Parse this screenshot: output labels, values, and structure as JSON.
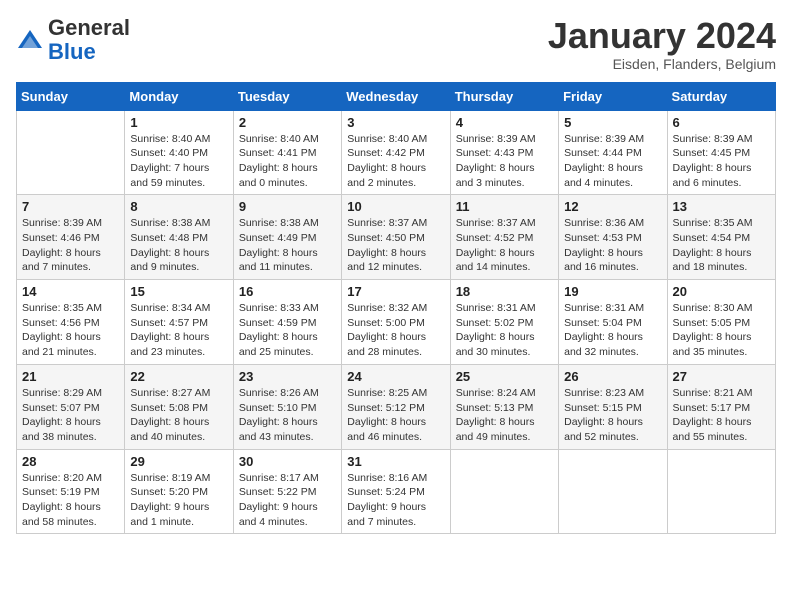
{
  "logo": {
    "general": "General",
    "blue": "Blue"
  },
  "header": {
    "month": "January 2024",
    "location": "Eisden, Flanders, Belgium"
  },
  "weekdays": [
    "Sunday",
    "Monday",
    "Tuesday",
    "Wednesday",
    "Thursday",
    "Friday",
    "Saturday"
  ],
  "weeks": [
    [
      {
        "day": "",
        "info": ""
      },
      {
        "day": "1",
        "info": "Sunrise: 8:40 AM\nSunset: 4:40 PM\nDaylight: 7 hours\nand 59 minutes."
      },
      {
        "day": "2",
        "info": "Sunrise: 8:40 AM\nSunset: 4:41 PM\nDaylight: 8 hours\nand 0 minutes."
      },
      {
        "day": "3",
        "info": "Sunrise: 8:40 AM\nSunset: 4:42 PM\nDaylight: 8 hours\nand 2 minutes."
      },
      {
        "day": "4",
        "info": "Sunrise: 8:39 AM\nSunset: 4:43 PM\nDaylight: 8 hours\nand 3 minutes."
      },
      {
        "day": "5",
        "info": "Sunrise: 8:39 AM\nSunset: 4:44 PM\nDaylight: 8 hours\nand 4 minutes."
      },
      {
        "day": "6",
        "info": "Sunrise: 8:39 AM\nSunset: 4:45 PM\nDaylight: 8 hours\nand 6 minutes."
      }
    ],
    [
      {
        "day": "7",
        "info": "Sunrise: 8:39 AM\nSunset: 4:46 PM\nDaylight: 8 hours\nand 7 minutes."
      },
      {
        "day": "8",
        "info": "Sunrise: 8:38 AM\nSunset: 4:48 PM\nDaylight: 8 hours\nand 9 minutes."
      },
      {
        "day": "9",
        "info": "Sunrise: 8:38 AM\nSunset: 4:49 PM\nDaylight: 8 hours\nand 11 minutes."
      },
      {
        "day": "10",
        "info": "Sunrise: 8:37 AM\nSunset: 4:50 PM\nDaylight: 8 hours\nand 12 minutes."
      },
      {
        "day": "11",
        "info": "Sunrise: 8:37 AM\nSunset: 4:52 PM\nDaylight: 8 hours\nand 14 minutes."
      },
      {
        "day": "12",
        "info": "Sunrise: 8:36 AM\nSunset: 4:53 PM\nDaylight: 8 hours\nand 16 minutes."
      },
      {
        "day": "13",
        "info": "Sunrise: 8:35 AM\nSunset: 4:54 PM\nDaylight: 8 hours\nand 18 minutes."
      }
    ],
    [
      {
        "day": "14",
        "info": "Sunrise: 8:35 AM\nSunset: 4:56 PM\nDaylight: 8 hours\nand 21 minutes."
      },
      {
        "day": "15",
        "info": "Sunrise: 8:34 AM\nSunset: 4:57 PM\nDaylight: 8 hours\nand 23 minutes."
      },
      {
        "day": "16",
        "info": "Sunrise: 8:33 AM\nSunset: 4:59 PM\nDaylight: 8 hours\nand 25 minutes."
      },
      {
        "day": "17",
        "info": "Sunrise: 8:32 AM\nSunset: 5:00 PM\nDaylight: 8 hours\nand 28 minutes."
      },
      {
        "day": "18",
        "info": "Sunrise: 8:31 AM\nSunset: 5:02 PM\nDaylight: 8 hours\nand 30 minutes."
      },
      {
        "day": "19",
        "info": "Sunrise: 8:31 AM\nSunset: 5:04 PM\nDaylight: 8 hours\nand 32 minutes."
      },
      {
        "day": "20",
        "info": "Sunrise: 8:30 AM\nSunset: 5:05 PM\nDaylight: 8 hours\nand 35 minutes."
      }
    ],
    [
      {
        "day": "21",
        "info": "Sunrise: 8:29 AM\nSunset: 5:07 PM\nDaylight: 8 hours\nand 38 minutes."
      },
      {
        "day": "22",
        "info": "Sunrise: 8:27 AM\nSunset: 5:08 PM\nDaylight: 8 hours\nand 40 minutes."
      },
      {
        "day": "23",
        "info": "Sunrise: 8:26 AM\nSunset: 5:10 PM\nDaylight: 8 hours\nand 43 minutes."
      },
      {
        "day": "24",
        "info": "Sunrise: 8:25 AM\nSunset: 5:12 PM\nDaylight: 8 hours\nand 46 minutes."
      },
      {
        "day": "25",
        "info": "Sunrise: 8:24 AM\nSunset: 5:13 PM\nDaylight: 8 hours\nand 49 minutes."
      },
      {
        "day": "26",
        "info": "Sunrise: 8:23 AM\nSunset: 5:15 PM\nDaylight: 8 hours\nand 52 minutes."
      },
      {
        "day": "27",
        "info": "Sunrise: 8:21 AM\nSunset: 5:17 PM\nDaylight: 8 hours\nand 55 minutes."
      }
    ],
    [
      {
        "day": "28",
        "info": "Sunrise: 8:20 AM\nSunset: 5:19 PM\nDaylight: 8 hours\nand 58 minutes."
      },
      {
        "day": "29",
        "info": "Sunrise: 8:19 AM\nSunset: 5:20 PM\nDaylight: 9 hours\nand 1 minute."
      },
      {
        "day": "30",
        "info": "Sunrise: 8:17 AM\nSunset: 5:22 PM\nDaylight: 9 hours\nand 4 minutes."
      },
      {
        "day": "31",
        "info": "Sunrise: 8:16 AM\nSunset: 5:24 PM\nDaylight: 9 hours\nand 7 minutes."
      },
      {
        "day": "",
        "info": ""
      },
      {
        "day": "",
        "info": ""
      },
      {
        "day": "",
        "info": ""
      }
    ]
  ]
}
